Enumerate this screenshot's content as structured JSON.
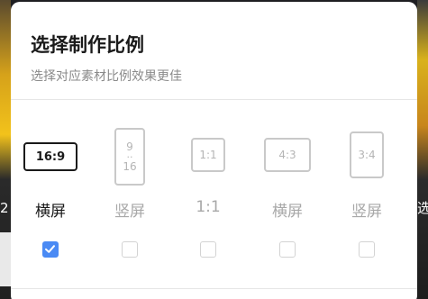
{
  "dialog": {
    "title": "选择制作比例",
    "subtitle": "选择对应素材比例效果更佳"
  },
  "options": [
    {
      "ratio": "16:9",
      "label": "横屏",
      "selected": true
    },
    {
      "ratio_top": "9",
      "ratio_mid": "··",
      "ratio_bottom": "16",
      "label": "竖屏",
      "selected": false
    },
    {
      "ratio": "1:1",
      "label": "1:1",
      "selected": false
    },
    {
      "ratio": "4:3",
      "label": "横屏",
      "selected": false
    },
    {
      "ratio": "3:4",
      "label": "竖屏",
      "selected": false
    }
  ],
  "background": {
    "left_glyph": "2",
    "right_glyph": "选"
  },
  "colors": {
    "accent": "#4a8af4",
    "selected_text": "#1a1a1a",
    "unselected_text": "#a8a8a8"
  },
  "icons": {
    "selected_check": "checkmark-icon"
  }
}
